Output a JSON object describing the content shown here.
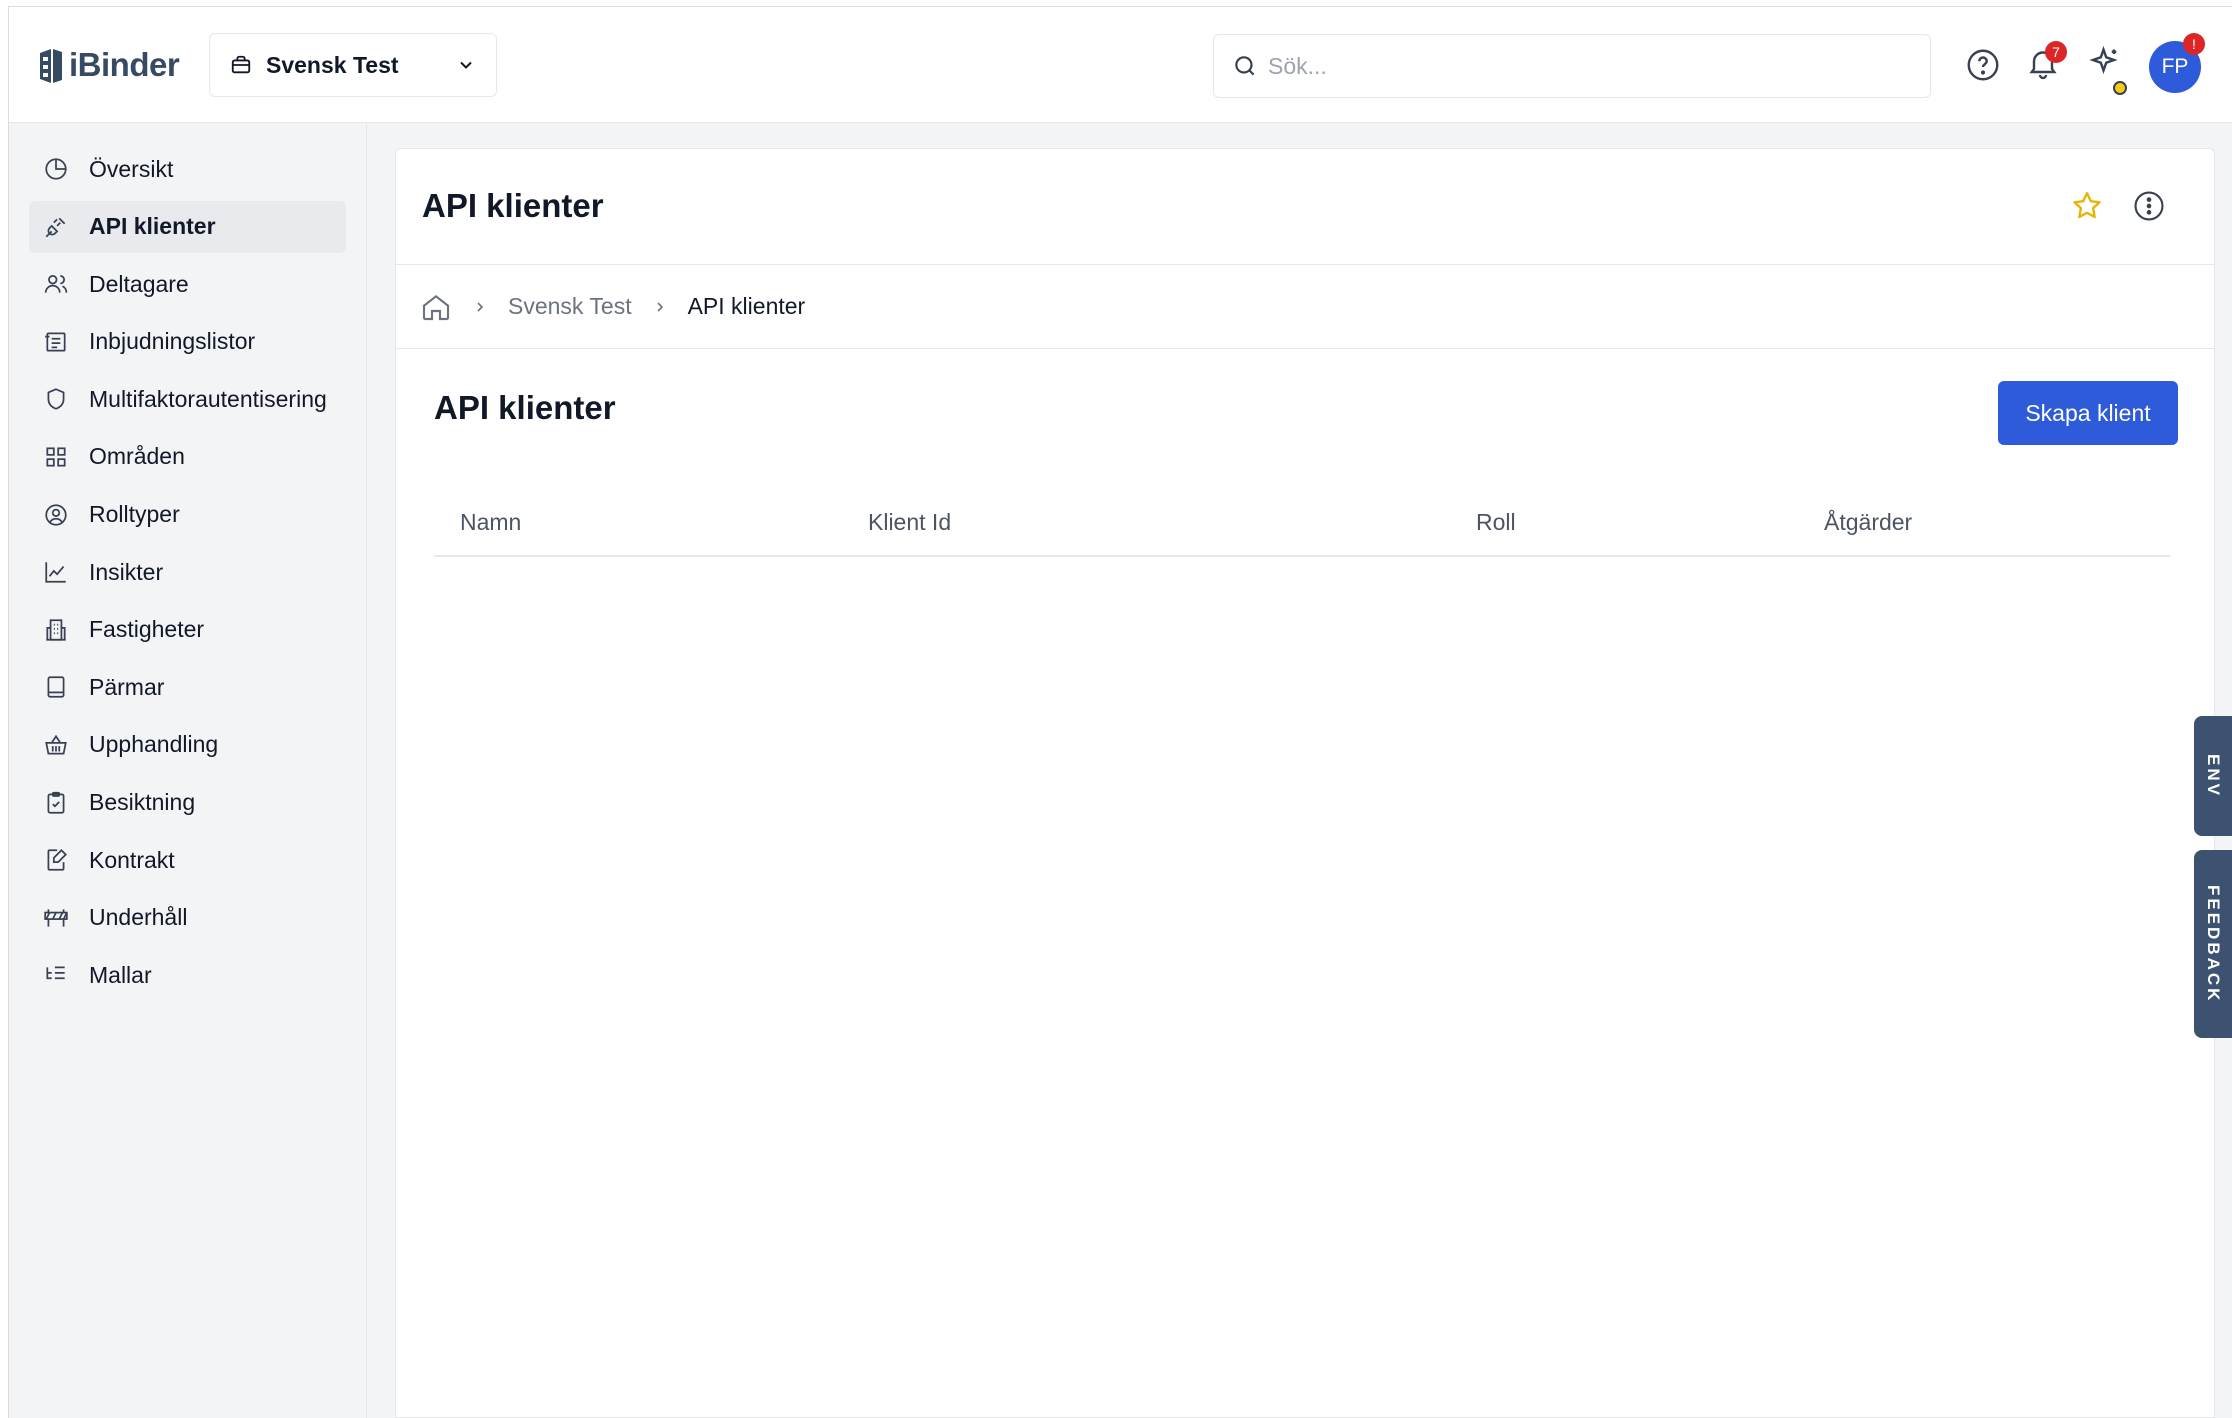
{
  "header": {
    "logo_text": "iBinder",
    "project_name": "Svensk Test",
    "search_placeholder": "Sök...",
    "notification_count": "7",
    "avatar_initials": "FP",
    "avatar_badge": "!"
  },
  "sidebar": {
    "items": [
      {
        "label": "Översikt",
        "icon": "pie-chart-icon"
      },
      {
        "label": "API klienter",
        "icon": "plug-icon",
        "active": true
      },
      {
        "label": "Deltagare",
        "icon": "users-icon"
      },
      {
        "label": "Inbjudningslistor",
        "icon": "invitation-list-icon"
      },
      {
        "label": "Multifaktorautentisering",
        "icon": "shield-icon"
      },
      {
        "label": "Områden",
        "icon": "grid-icon"
      },
      {
        "label": "Rolltyper",
        "icon": "user-circle-icon"
      },
      {
        "label": "Insikter",
        "icon": "line-chart-icon"
      },
      {
        "label": "Fastigheter",
        "icon": "building-icon"
      },
      {
        "label": "Pärmar",
        "icon": "book-icon"
      },
      {
        "label": "Upphandling",
        "icon": "basket-icon"
      },
      {
        "label": "Besiktning",
        "icon": "clipboard-check-icon"
      },
      {
        "label": "Kontrakt",
        "icon": "file-edit-icon"
      },
      {
        "label": "Underhåll",
        "icon": "barrier-icon"
      },
      {
        "label": "Mallar",
        "icon": "list-tree-icon"
      }
    ]
  },
  "page": {
    "title": "API klienter",
    "breadcrumb": [
      "Svensk Test",
      "API klienter"
    ],
    "section_title": "API klienter",
    "create_button": "Skapa klient",
    "table": {
      "columns": [
        "Namn",
        "Klient Id",
        "Roll",
        "Åtgärder"
      ],
      "rows": []
    }
  },
  "side_tabs": [
    "ENV",
    "FEEDBACK"
  ],
  "colors": {
    "primary": "#2d5bd9",
    "star": "#eab308",
    "notification_badge": "#dc2626",
    "side_tab": "#3d5170"
  }
}
